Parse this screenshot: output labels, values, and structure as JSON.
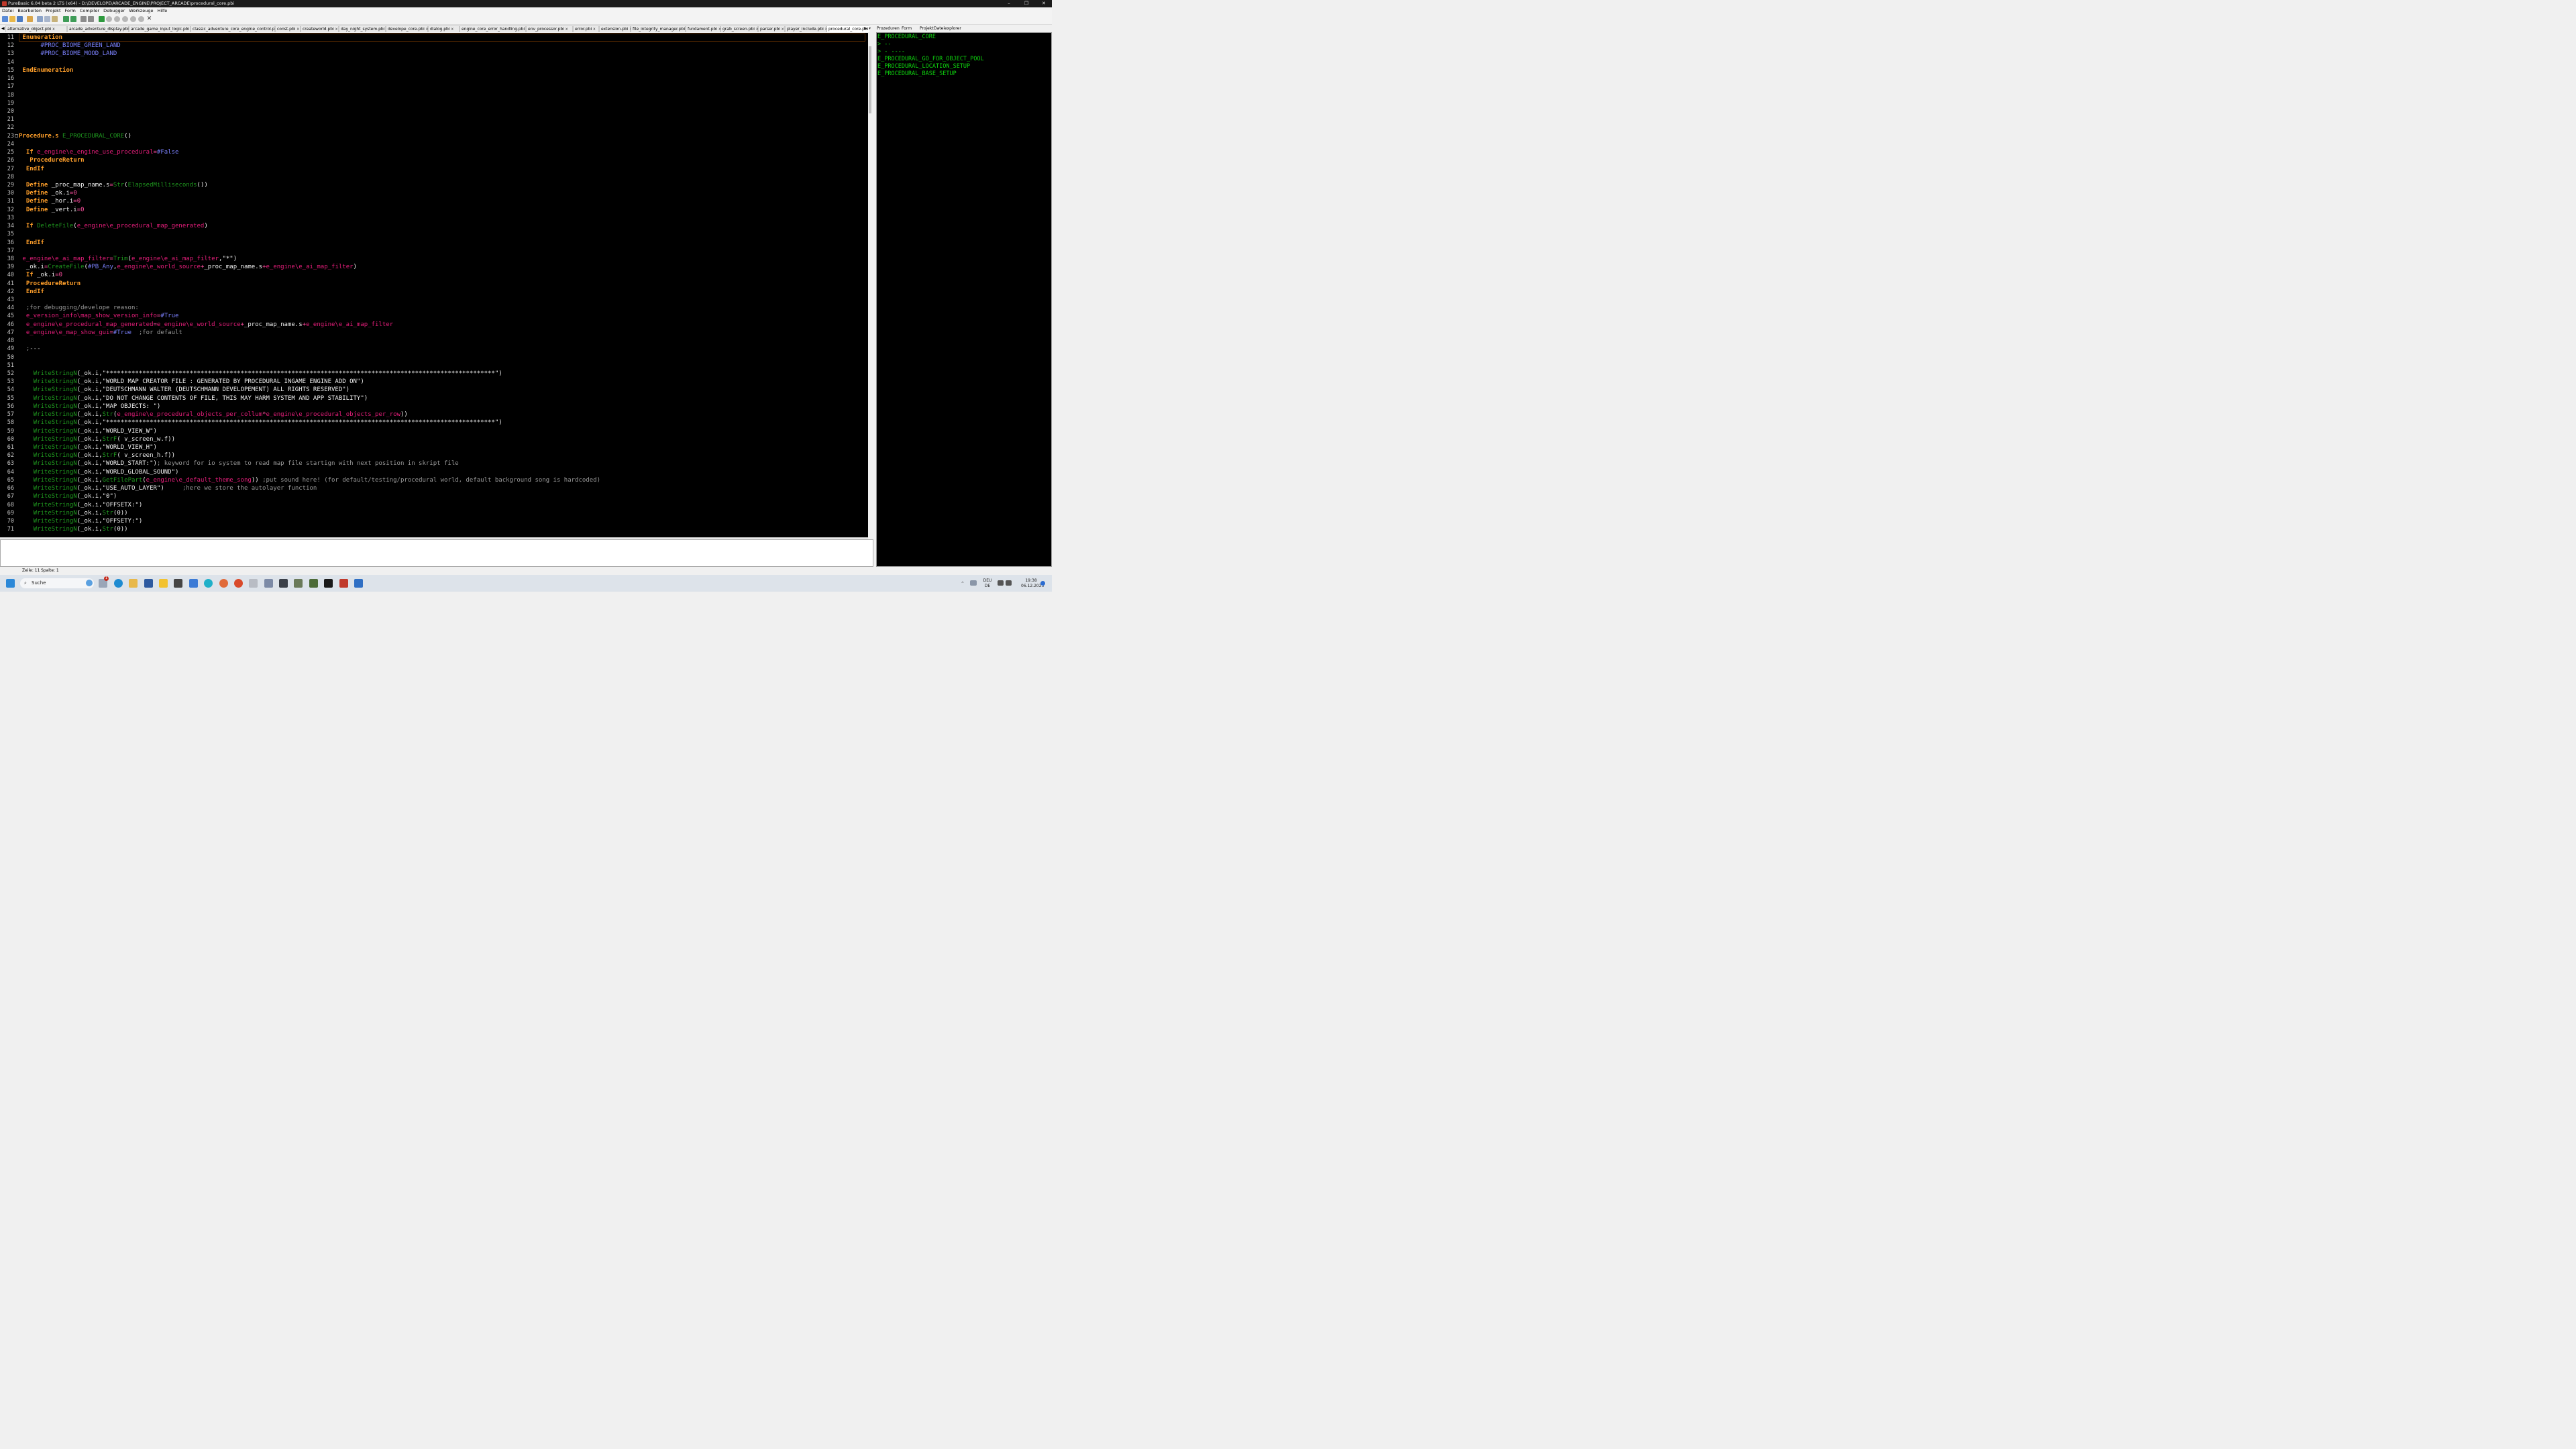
{
  "window": {
    "title": "PureBasic 6.04 beta 2 LTS (x64) - D:\\DEVELOPE\\ARCADE_ENGINE\\PROJECT_ARCADE\\procedural_core.pbi",
    "minimize": "–",
    "maximize": "❐",
    "close": "✕"
  },
  "menu": [
    "Datei",
    "Bearbeiten",
    "Projekt",
    "Form",
    "Compiler",
    "Debugger",
    "Werkzeuge",
    "Hilfe"
  ],
  "tabs": [
    "alternative_object.pbi",
    "arcade_adventure_display.pbi",
    "arcade_game_input_logic.pbi",
    "classic_adventure_core_engine_control.pbi",
    "const.pbi",
    "createworld.pbi",
    "day_night_system.pbi",
    "develope_core.pbi",
    "dialog.pbi",
    "engine_core_error_handling.pbi",
    "env_processor.pbi",
    "error.pbi",
    "extension.pbi",
    "file_integrity_manager.pbi",
    "fundament.pbi",
    "grab_screen.pbi",
    "parser.pbi",
    "player_include.pbi",
    "procedural_core.pbi",
    "pro"
  ],
  "active_tab": "procedural_core.pbi",
  "tab_close_glyph": "x",
  "tab_nav": {
    "left": "◀",
    "right": "▶",
    "menu": "▾"
  },
  "right_panel": {
    "tabs": [
      "Prozeduren",
      "Form",
      "Projekt",
      "Dateiexplorer"
    ],
    "items": [
      "E_PROCEDURAL_CORE",
      "> --",
      "> - ----",
      "E_PROCEDURAL_GO_FOR_OBJECT_POOL",
      "E_PROCEDURAL_LOCATION_SETUP",
      "E_PROCEDURAL_BASE_SETUP"
    ]
  },
  "colors": {
    "keyword": "#ff9f2a",
    "function": "#1f9a1f",
    "constant": "#7c82ff",
    "variable": "#e81e7c",
    "text": "#f0f0f0",
    "string": "#f0f0f0",
    "comment": "#9a9a9a",
    "operator": "#ff4fa0",
    "number": "#ff4fa0",
    "folding": "#7a7a7a"
  },
  "code_lines": [
    {
      "n": "11",
      "t": [
        [
          "k",
          " Enumeration"
        ]
      ]
    },
    {
      "n": "12",
      "t": [
        [
          "c",
          "      #PROC_BIOME_GREEN_LAND"
        ]
      ]
    },
    {
      "n": "13",
      "t": [
        [
          "c",
          "      #PROC_BIOME_MOOD_LAND"
        ]
      ]
    },
    {
      "n": "14",
      "t": []
    },
    {
      "n": "15",
      "t": [
        [
          "k",
          " EndEnumeration"
        ]
      ]
    },
    {
      "n": "16",
      "t": []
    },
    {
      "n": "17",
      "t": []
    },
    {
      "n": "18",
      "t": []
    },
    {
      "n": "19",
      "t": []
    },
    {
      "n": "20",
      "t": []
    },
    {
      "n": "21",
      "t": []
    },
    {
      "n": "22",
      "t": []
    },
    {
      "n": "23",
      "t": [
        [
          "k",
          "Procedure.s "
        ],
        [
          "f",
          "E_PROCEDURAL_CORE"
        ],
        [
          "x",
          "()"
        ]
      ]
    },
    {
      "n": "24",
      "t": []
    },
    {
      "n": "25",
      "t": [
        [
          "k",
          "  If "
        ],
        [
          "v",
          "e_engine\\e_engine_use_procedural"
        ],
        [
          "o",
          "="
        ],
        [
          "c",
          "#False"
        ]
      ]
    },
    {
      "n": "26",
      "t": [
        [
          "k",
          "   ProcedureReturn"
        ]
      ]
    },
    {
      "n": "27",
      "t": [
        [
          "k",
          "  EndIf"
        ]
      ]
    },
    {
      "n": "28",
      "t": []
    },
    {
      "n": "29",
      "t": [
        [
          "k",
          "  Define "
        ],
        [
          "x",
          "_proc_map_name.s"
        ],
        [
          "o",
          "="
        ],
        [
          "f",
          "Str"
        ],
        [
          "x",
          "("
        ],
        [
          "f",
          "ElapsedMilliseconds"
        ],
        [
          "x",
          "())"
        ]
      ]
    },
    {
      "n": "30",
      "t": [
        [
          "k",
          "  Define "
        ],
        [
          "x",
          "_ok.i"
        ],
        [
          "o",
          "=0"
        ]
      ]
    },
    {
      "n": "31",
      "t": [
        [
          "k",
          "  Define "
        ],
        [
          "x",
          "_hor.i"
        ],
        [
          "o",
          "=0"
        ]
      ]
    },
    {
      "n": "32",
      "t": [
        [
          "k",
          "  Define "
        ],
        [
          "x",
          "_vert.i"
        ],
        [
          "o",
          "=0"
        ]
      ]
    },
    {
      "n": "33",
      "t": []
    },
    {
      "n": "34",
      "t": [
        [
          "k",
          "  If "
        ],
        [
          "f",
          "DeleteFile"
        ],
        [
          "x",
          "("
        ],
        [
          "v",
          "e_engine\\e_procedural_map_generated"
        ],
        [
          "x",
          ")"
        ]
      ]
    },
    {
      "n": "35",
      "t": []
    },
    {
      "n": "36",
      "t": [
        [
          "k",
          "  EndIf"
        ]
      ]
    },
    {
      "n": "37",
      "t": []
    },
    {
      "n": "38",
      "t": [
        [
          "v",
          " e_engine\\e_ai_map_filter"
        ],
        [
          "o",
          "="
        ],
        [
          "f",
          "Trim"
        ],
        [
          "x",
          "("
        ],
        [
          "v",
          "e_engine\\e_ai_map_filter"
        ],
        [
          "x",
          ",\"*\")"
        ]
      ]
    },
    {
      "n": "39",
      "t": [
        [
          "x",
          "  _ok.i"
        ],
        [
          "o",
          "="
        ],
        [
          "f",
          "CreateFile"
        ],
        [
          "x",
          "("
        ],
        [
          "c",
          "#PB_Any"
        ],
        [
          "x",
          ","
        ],
        [
          "v",
          "e_engine\\e_world_source"
        ],
        [
          "o",
          "+"
        ],
        [
          "x",
          "_proc_map_name.s"
        ],
        [
          "o",
          "+"
        ],
        [
          "v",
          "e_engine\\e_ai_map_filter"
        ],
        [
          "x",
          ")"
        ]
      ]
    },
    {
      "n": "40",
      "t": [
        [
          "k",
          "  If "
        ],
        [
          "x",
          "_ok.i"
        ],
        [
          "o",
          "=0"
        ]
      ]
    },
    {
      "n": "41",
      "t": [
        [
          "k",
          "  ProcedureReturn"
        ]
      ]
    },
    {
      "n": "42",
      "t": [
        [
          "k",
          "  EndIf"
        ]
      ]
    },
    {
      "n": "43",
      "t": []
    },
    {
      "n": "44",
      "t": [
        [
          "m",
          "  ;for debugging/develope reason:"
        ]
      ]
    },
    {
      "n": "45",
      "t": [
        [
          "v",
          "  e_version_info\\map_show_version_info"
        ],
        [
          "o",
          "="
        ],
        [
          "c",
          "#True"
        ]
      ]
    },
    {
      "n": "46",
      "t": [
        [
          "v",
          "  e_engine\\e_procedural_map_generated"
        ],
        [
          "o",
          "="
        ],
        [
          "v",
          "e_engine\\e_world_source"
        ],
        [
          "o",
          "+"
        ],
        [
          "x",
          "_proc_map_name.s"
        ],
        [
          "o",
          "+"
        ],
        [
          "v",
          "e_engine\\e_ai_map_filter"
        ]
      ]
    },
    {
      "n": "47",
      "t": [
        [
          "v",
          "  e_engine\\e_map_show_gui"
        ],
        [
          "o",
          "="
        ],
        [
          "c",
          "#True"
        ],
        [
          "m",
          "  ;for default"
        ]
      ]
    },
    {
      "n": "48",
      "t": []
    },
    {
      "n": "49",
      "t": [
        [
          "m",
          "  ;---"
        ]
      ]
    },
    {
      "n": "50",
      "t": []
    },
    {
      "n": "51",
      "t": []
    },
    {
      "n": "52",
      "t": [
        [
          "f",
          "    WriteStringN"
        ],
        [
          "x",
          "(_ok.i,\"***********************************************************************************************************\")"
        ]
      ]
    },
    {
      "n": "53",
      "t": [
        [
          "f",
          "    WriteStringN"
        ],
        [
          "x",
          "(_ok.i,\"WORLD MAP CREATOR FILE : GENERATED BY PROCEDURAL INGAME ENGINE ADD ON\")"
        ]
      ]
    },
    {
      "n": "54",
      "t": [
        [
          "f",
          "    WriteStringN"
        ],
        [
          "x",
          "(_ok.i,\"DEUTSCHMANN WALTER (DEUTSCHMANN DEVELOPEMENT) ALL RIGHTS RESERVED\")"
        ]
      ]
    },
    {
      "n": "55",
      "t": [
        [
          "f",
          "    WriteStringN"
        ],
        [
          "x",
          "(_ok.i,\"DO NOT CHANGE CONTENTS OF FILE, THIS MAY HARM SYSTEM AND APP STABILITY\")"
        ]
      ]
    },
    {
      "n": "56",
      "t": [
        [
          "f",
          "    WriteStringN"
        ],
        [
          "x",
          "(_ok.i,\"MAP OBJECTS: \")"
        ]
      ]
    },
    {
      "n": "57",
      "t": [
        [
          "f",
          "    WriteStringN"
        ],
        [
          "x",
          "(_ok.i,"
        ],
        [
          "f",
          "Str"
        ],
        [
          "x",
          "("
        ],
        [
          "v",
          "e_engine\\e_procedural_objects_per_collum"
        ],
        [
          "o",
          "*"
        ],
        [
          "v",
          "e_engine\\e_procedural_objects_per_row"
        ],
        [
          "x",
          "))"
        ]
      ]
    },
    {
      "n": "58",
      "t": [
        [
          "f",
          "    WriteStringN"
        ],
        [
          "x",
          "(_ok.i,\"***********************************************************************************************************\")"
        ]
      ]
    },
    {
      "n": "59",
      "t": [
        [
          "f",
          "    WriteStringN"
        ],
        [
          "x",
          "(_ok.i,\"WORLD_VIEW_W\")"
        ]
      ]
    },
    {
      "n": "60",
      "t": [
        [
          "f",
          "    WriteStringN"
        ],
        [
          "x",
          "(_ok.i,"
        ],
        [
          "f",
          "StrF"
        ],
        [
          "x",
          "( v_screen_w.f))"
        ]
      ]
    },
    {
      "n": "61",
      "t": [
        [
          "f",
          "    WriteStringN"
        ],
        [
          "x",
          "(_ok.i,\"WORLD_VIEW_H\")"
        ]
      ]
    },
    {
      "n": "62",
      "t": [
        [
          "f",
          "    WriteStringN"
        ],
        [
          "x",
          "(_ok.i,"
        ],
        [
          "f",
          "StrF"
        ],
        [
          "x",
          "( v_screen_h.f))"
        ]
      ]
    },
    {
      "n": "63",
      "t": [
        [
          "f",
          "    WriteStringN"
        ],
        [
          "x",
          "(_ok.i,\"WORLD_START:\")"
        ],
        [
          "m",
          "; keyword for io system to read map file startign with next position in skript file"
        ]
      ]
    },
    {
      "n": "64",
      "t": [
        [
          "f",
          "    WriteStringN"
        ],
        [
          "x",
          "(_ok.i,\"WORLD_GLOBAL_SOUND\")"
        ]
      ]
    },
    {
      "n": "65",
      "t": [
        [
          "f",
          "    WriteStringN"
        ],
        [
          "x",
          "(_ok.i,"
        ],
        [
          "f",
          "GetFilePart"
        ],
        [
          "x",
          "("
        ],
        [
          "v",
          "e_engine\\e_default_theme_song"
        ],
        [
          "x",
          "))"
        ],
        [
          "m",
          " ;put sound here! (for default/testing/procedural world, default background song is hardcoded)"
        ]
      ]
    },
    {
      "n": "66",
      "t": [
        [
          "f",
          "    WriteStringN"
        ],
        [
          "x",
          "(_ok.i,\"USE_AUTO_LAYER\")"
        ],
        [
          "m",
          "     ;here we store the autolayer function"
        ]
      ]
    },
    {
      "n": "67",
      "t": [
        [
          "f",
          "    WriteStringN"
        ],
        [
          "x",
          "(_ok.i,\"0\")"
        ]
      ]
    },
    {
      "n": "68",
      "t": [
        [
          "f",
          "    WriteStringN"
        ],
        [
          "x",
          "(_ok.i,\"OFFSETX:\")"
        ]
      ]
    },
    {
      "n": "69",
      "t": [
        [
          "f",
          "    WriteStringN"
        ],
        [
          "x",
          "(_ok.i,"
        ],
        [
          "f",
          "Str"
        ],
        [
          "x",
          "(0))"
        ]
      ]
    },
    {
      "n": "70",
      "t": [
        [
          "f",
          "    WriteStringN"
        ],
        [
          "x",
          "(_ok.i,\"OFFSETY:\")"
        ]
      ]
    },
    {
      "n": "71",
      "t": [
        [
          "f",
          "    WriteStringN"
        ],
        [
          "x",
          "(_ok.i,"
        ],
        [
          "f",
          "Str"
        ],
        [
          "x",
          "(0))"
        ]
      ]
    }
  ],
  "statusbar": {
    "line": "Zeile: 11",
    "column": "Spalte: 1"
  },
  "taskbar": {
    "search_placeholder": "Suche",
    "notification_count": "1",
    "lang_top": "DEU",
    "lang_bottom": "DE",
    "time": "19:38",
    "date": "06.12.2023"
  }
}
